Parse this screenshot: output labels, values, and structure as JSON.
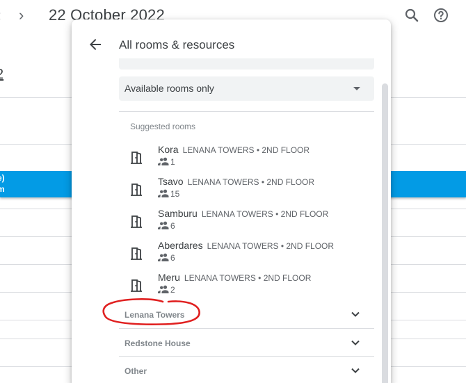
{
  "header": {
    "prev_label": "‹",
    "next_label": "›",
    "date_title": "22 October 2022",
    "search_icon": "search-icon",
    "help_icon": "help-icon"
  },
  "background": {
    "small_label": "-",
    "day_number": "2",
    "event_line1": "e)",
    "event_line2": "m",
    "event_color": "#039be5"
  },
  "panel": {
    "title": "All rooms & resources",
    "filter": {
      "selected": "Available rooms only"
    },
    "suggested_label": "Suggested rooms",
    "rooms": [
      {
        "name": "Kora",
        "location": "LENANA TOWERS • 2ND FLOOR",
        "capacity": "1"
      },
      {
        "name": "Tsavo",
        "location": "LENANA TOWERS • 2ND FLOOR",
        "capacity": "15"
      },
      {
        "name": "Samburu",
        "location": "LENANA TOWERS • 2ND FLOOR",
        "capacity": "6"
      },
      {
        "name": "Aberdares",
        "location": "LENANA TOWERS • 2ND FLOOR",
        "capacity": "6"
      },
      {
        "name": "Meru",
        "location": "LENANA TOWERS • 2ND FLOOR",
        "capacity": "2"
      }
    ],
    "groups": [
      {
        "label": "Lenana Towers"
      },
      {
        "label": "Redstone House"
      },
      {
        "label": "Other"
      }
    ]
  },
  "colors": {
    "annotation": "#e02020",
    "text_primary": "#3c4043",
    "text_secondary": "#5f6368"
  }
}
